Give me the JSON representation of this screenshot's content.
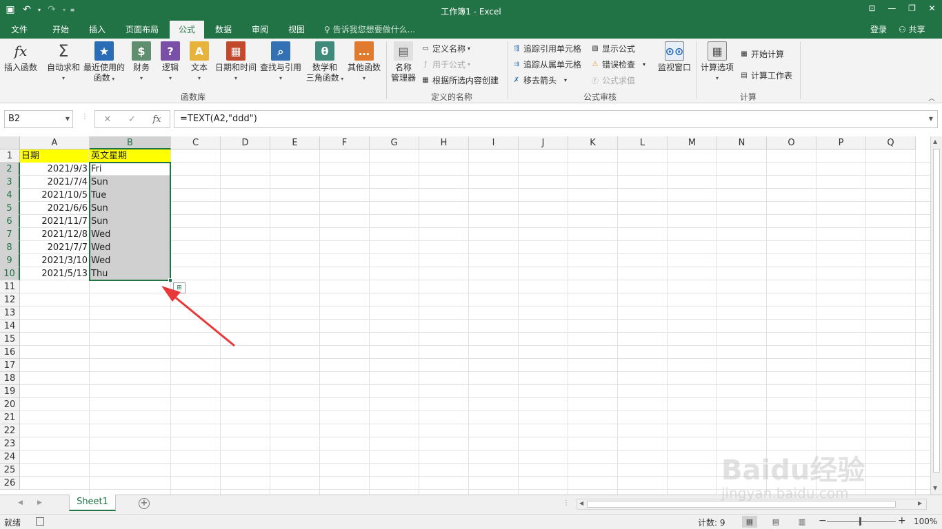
{
  "window": {
    "title": "工作簿1 - Excel"
  },
  "tabs": [
    {
      "label": "文件"
    },
    {
      "label": "开始"
    },
    {
      "label": "插入"
    },
    {
      "label": "页面布局"
    },
    {
      "label": "公式"
    },
    {
      "label": "数据"
    },
    {
      "label": "审阅"
    },
    {
      "label": "视图"
    }
  ],
  "tell_me": "告诉我您想要做什么...",
  "account": {
    "login": "登录",
    "share": "共享"
  },
  "ribbon": {
    "function_library": {
      "group_label": "函数库",
      "buttons": [
        {
          "label": "插入函数",
          "icon": "fx-icon"
        },
        {
          "label": "自动求和",
          "icon": "sigma-icon"
        },
        {
          "label": "最近使用的",
          "label2": "函数",
          "icon": "star-book-icon"
        },
        {
          "label": "财务",
          "icon": "finance-book-icon"
        },
        {
          "label": "逻辑",
          "icon": "question-book-icon"
        },
        {
          "label": "文本",
          "icon": "text-book-icon"
        },
        {
          "label": "日期和时间",
          "icon": "calendar-book-icon"
        },
        {
          "label": "查找与引用",
          "icon": "search-book-icon"
        },
        {
          "label": "数学和",
          "label2": "三角函数",
          "icon": "theta-book-icon"
        },
        {
          "label": "其他函数",
          "icon": "more-book-icon"
        }
      ]
    },
    "defined_names": {
      "group_label": "定义的名称",
      "name_manager": "名称",
      "name_manager2": "管理器",
      "define_name": "定义名称",
      "use_in_formula": "用于公式",
      "create_from_selection": "根据所选内容创建"
    },
    "formula_auditing": {
      "group_label": "公式审核",
      "trace_precedents": "追踪引用单元格",
      "trace_dependents": "追踪从属单元格",
      "remove_arrows": "移去箭头",
      "show_formulas": "显示公式",
      "error_checking": "错误检查",
      "evaluate_formula": "公式求值",
      "watch_window": "监视窗口"
    },
    "calculation": {
      "group_label": "计算",
      "calc_options": "计算选项",
      "calc_now": "开始计算",
      "calc_sheet": "计算工作表"
    }
  },
  "formula_bar": {
    "name_box": "B2",
    "formula": "=TEXT(A2,\"ddd\")"
  },
  "grid": {
    "columns": [
      "A",
      "B",
      "C",
      "D",
      "E",
      "F",
      "G",
      "H",
      "I",
      "J",
      "K",
      "L",
      "M",
      "N",
      "O",
      "P",
      "Q"
    ],
    "rows": [
      "1",
      "2",
      "3",
      "4",
      "5",
      "6",
      "7",
      "8",
      "9",
      "10",
      "11",
      "12",
      "13",
      "14",
      "15",
      "16",
      "17",
      "18",
      "19",
      "20",
      "21",
      "22",
      "23",
      "24",
      "25",
      "26"
    ],
    "header_row": {
      "a": "日期",
      "b": "英文星期"
    },
    "data": [
      {
        "date": "2021/9/3",
        "weekday": "Fri"
      },
      {
        "date": "2021/7/4",
        "weekday": "Sun"
      },
      {
        "date": "2021/10/5",
        "weekday": "Tue"
      },
      {
        "date": "2021/6/6",
        "weekday": "Sun"
      },
      {
        "date": "2021/11/7",
        "weekday": "Sun"
      },
      {
        "date": "2021/12/8",
        "weekday": "Wed"
      },
      {
        "date": "2021/7/7",
        "weekday": "Wed"
      },
      {
        "date": "2021/3/10",
        "weekday": "Wed"
      },
      {
        "date": "2021/5/13",
        "weekday": "Thu"
      }
    ],
    "header_fill": "#ffff00",
    "selection_fill": "#d0d0d0",
    "accent": "#217346"
  },
  "sheets": [
    {
      "label": "Sheet1"
    }
  ],
  "status": {
    "ready": "就绪",
    "count": "计数: 9",
    "zoom": "100%"
  },
  "watermark": {
    "line1": "Bai",
    "line1b": "du",
    "line1c": "经验",
    "line2": "jingyan.baidu.com"
  }
}
